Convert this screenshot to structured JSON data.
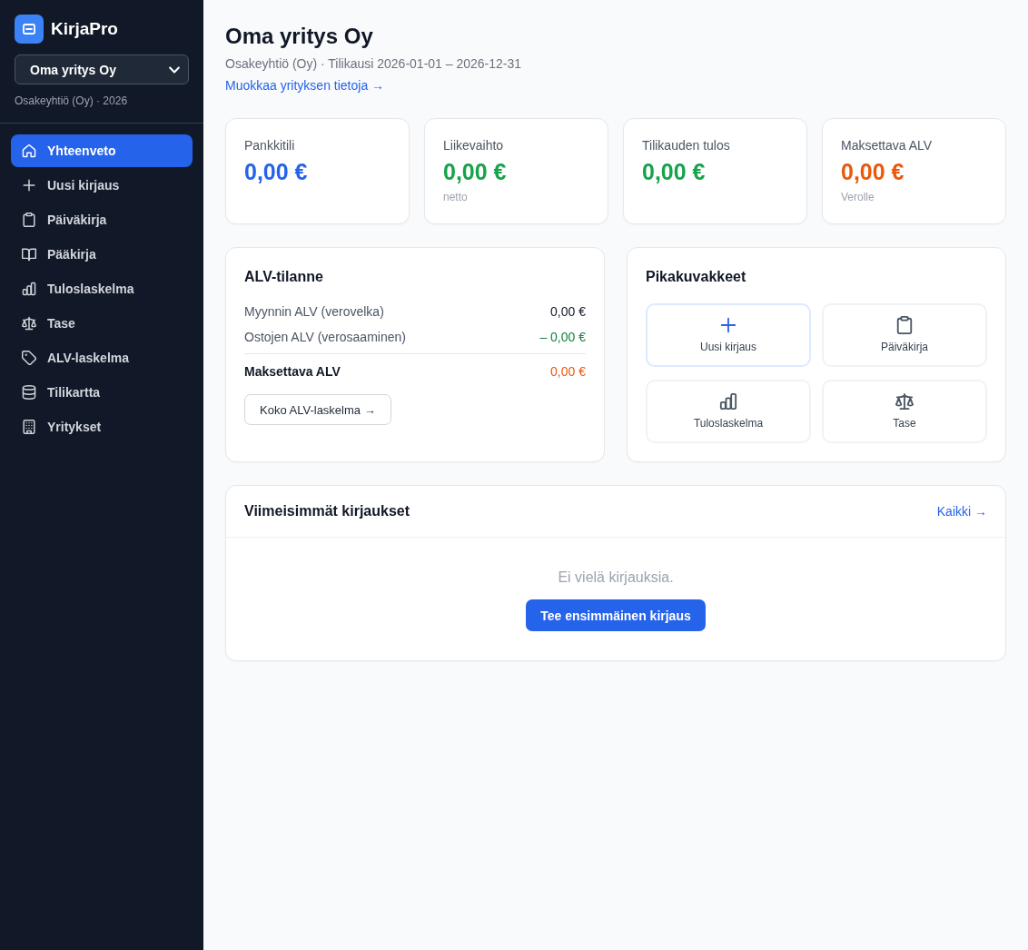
{
  "sidebar": {
    "app_name": "KirjaPro",
    "company_select": {
      "value": "Oma yritys Oy"
    },
    "company_info": "Osakeyhtiö (Oy) · 2026",
    "nav": [
      {
        "label": "Yhteenveto",
        "selected": true
      },
      {
        "label": "Uusi kirjaus",
        "selected": false
      },
      {
        "label": "Päiväkirja",
        "selected": false
      },
      {
        "label": "Pääkirja",
        "selected": false
      },
      {
        "label": "Tuloslaskelma",
        "selected": false
      },
      {
        "label": "Tase",
        "selected": false
      },
      {
        "label": "ALV-laskelma",
        "selected": false
      },
      {
        "label": "Tilikartta",
        "selected": false
      },
      {
        "label": "Yritykset",
        "selected": false
      }
    ]
  },
  "header": {
    "title": "Oma yritys Oy",
    "subtitle": "Osakeyhtiö (Oy) · Tilikausi 2026-01-01 – 2026-12-31",
    "link": "Muokkaa yrityksen tietoja →"
  },
  "stats": [
    {
      "label": "Pankkitili",
      "value": "0,00 €",
      "color": "#2563eb"
    },
    {
      "label": "Liikevaihto",
      "value": "0,00 €",
      "color": "#16a34a",
      "note": "netto"
    },
    {
      "label": "Tilikauden tulos",
      "value": "0,00 €",
      "color": "#16a34a"
    },
    {
      "label": "Maksettava ALV",
      "value": "0,00 €",
      "color": "#ea580c",
      "note": "Verolle"
    }
  ],
  "vat": {
    "title": "ALV-tilanne",
    "rows": [
      {
        "kind": "plain",
        "label": "Myynnin ALV (verovelka)",
        "amount": "0,00 €"
      },
      {
        "kind": "deduction",
        "label": "Ostojen ALV (verosaaminen)",
        "amount": "– 0,00 €"
      },
      {
        "kind": "total",
        "label": "Maksettava ALV",
        "amount": "0,00 €"
      }
    ],
    "button": "Koko ALV-laskelma →"
  },
  "shortcuts": {
    "title": "Pikakuvakkeet",
    "items": [
      {
        "label": "Uusi kirjaus",
        "highlighted": true
      },
      {
        "label": "Päiväkirja",
        "highlighted": false
      },
      {
        "label": "Tuloslaskelma",
        "highlighted": false
      },
      {
        "label": "Tase",
        "highlighted": false
      }
    ]
  },
  "recent": {
    "title": "Viimeisimmät kirjaukset",
    "link": "Kaikki →",
    "empty_text": "Ei vielä kirjauksia.",
    "button": "Tee ensimmäinen kirjaus"
  }
}
